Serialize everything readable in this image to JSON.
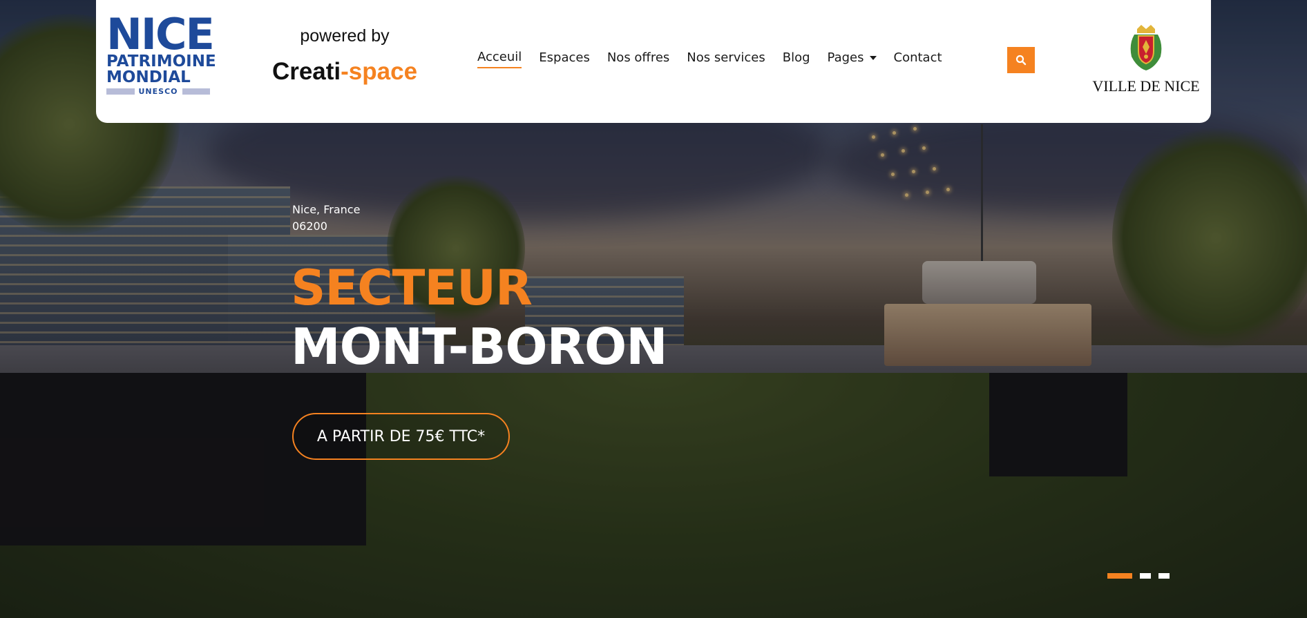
{
  "header": {
    "unesco_logo": {
      "line1": "NICE",
      "line2": "PATRIMOINE",
      "line3": "MONDIAL",
      "line4": "UNESCO"
    },
    "powered_by": "powered by",
    "brand": {
      "part1": "Creati",
      "part2": "-space"
    },
    "nav": [
      {
        "label": "Acceuil",
        "active": true
      },
      {
        "label": "Espaces"
      },
      {
        "label": "Nos offres"
      },
      {
        "label": "Nos services"
      },
      {
        "label": "Blog"
      },
      {
        "label": "Pages",
        "dropdown": true
      },
      {
        "label": "Contact"
      }
    ],
    "search_icon": "search-icon",
    "city_logo": {
      "name": "VILLE DE NICE",
      "icon": "city-crest-icon"
    }
  },
  "hero": {
    "location_line1": "Nice, France",
    "location_line2": "06200",
    "title_line1": "SECTEUR",
    "title_line2": "MONT-BORON",
    "cta_label": "A PARTIR DE 75€ TTC*"
  },
  "slider": {
    "total": 3,
    "active_index": 0
  },
  "colors": {
    "accent": "#f58220",
    "unesco_blue": "#1e4a9a",
    "header_bg": "#ffffff"
  }
}
